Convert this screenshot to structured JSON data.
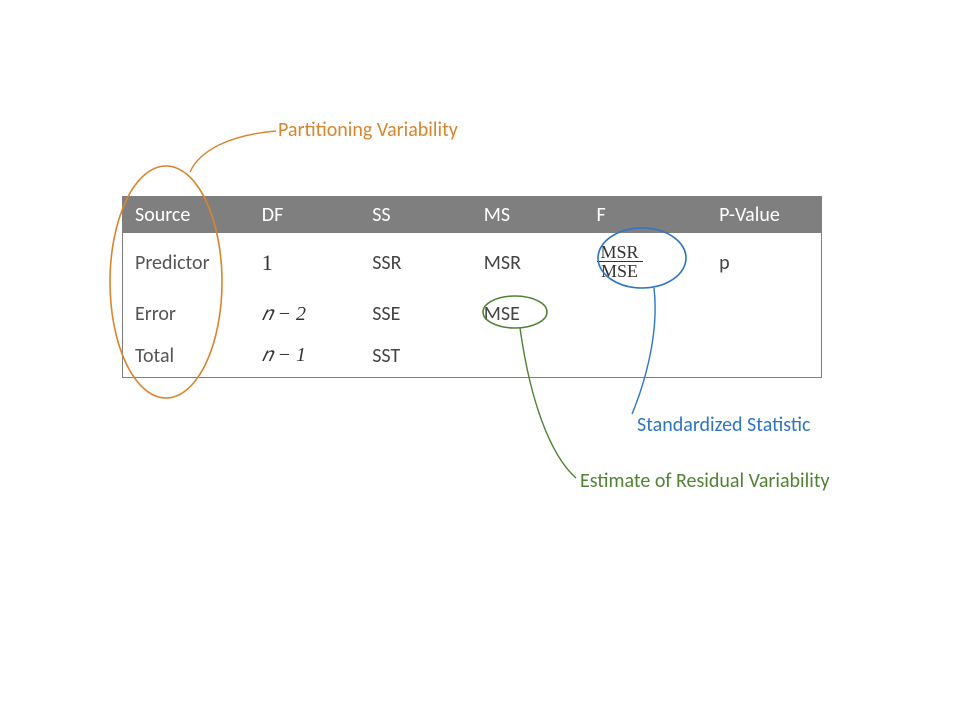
{
  "annotations": {
    "partitioning": "Partitioning Variability",
    "standardized": "Standardized Statistic",
    "residual": "Estimate of Residual Variability"
  },
  "table": {
    "headers": {
      "source": "Source",
      "df": "DF",
      "ss": "SS",
      "ms": "MS",
      "f": "F",
      "p": "P-Value"
    },
    "rows": {
      "predictor": {
        "source": "Predictor",
        "df": "1",
        "ss": "SSR",
        "ms": "MSR",
        "f_num": "MSR",
        "f_den": "MSE",
        "p": "p"
      },
      "error": {
        "source": "Error",
        "df": "𝑛  −  2",
        "ss": "SSE",
        "ms": "MSE"
      },
      "total": {
        "source": "Total",
        "df": "𝑛  −  1",
        "ss": "SST"
      }
    }
  },
  "colors": {
    "orange": "#d8852e",
    "blue": "#2e75c6",
    "green": "#538234",
    "header_bg": "#7f7f7f"
  }
}
